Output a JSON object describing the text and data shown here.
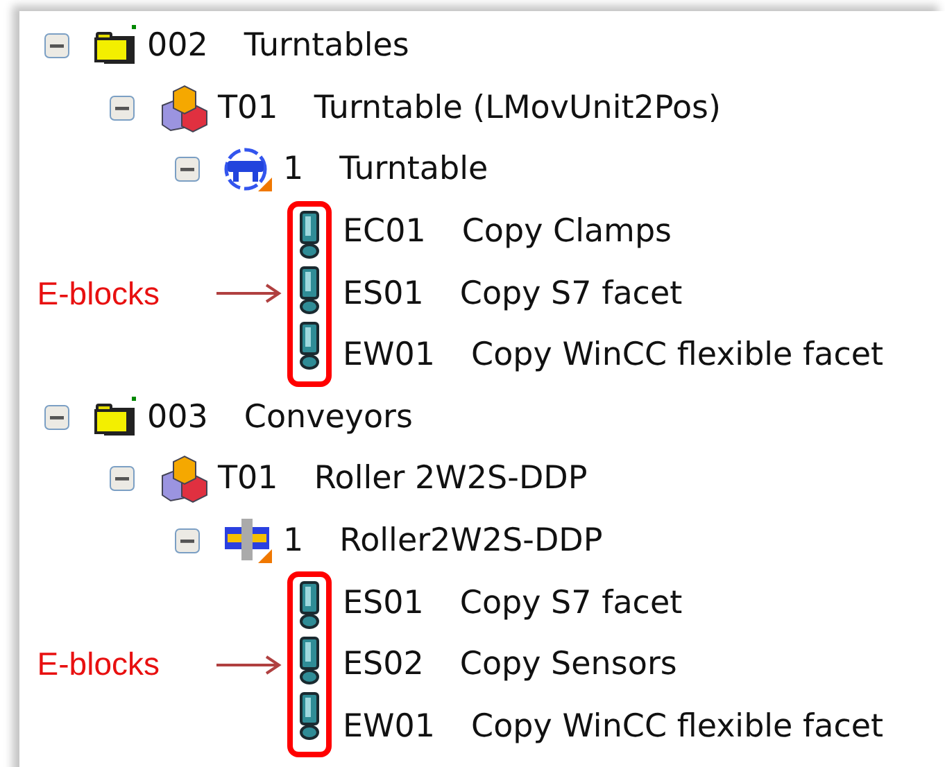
{
  "tree": [
    {
      "kind": "folder",
      "code": "002",
      "name": "Turntables",
      "expanded": true,
      "children": [
        {
          "kind": "unit",
          "code": "T01",
          "name": "Turntable (LMovUnit2Pos)",
          "expanded": true,
          "children": [
            {
              "kind": "turntable",
              "code": "1",
              "name": "Turntable",
              "expanded": true,
              "annotation": "E-blocks",
              "children": [
                {
                  "kind": "eblock",
                  "code": "EC01",
                  "name": "Copy Clamps"
                },
                {
                  "kind": "eblock",
                  "code": "ES01",
                  "name": "Copy S7 facet"
                },
                {
                  "kind": "eblock",
                  "code": "EW01",
                  "name": "Copy WinCC flexible facet"
                }
              ]
            }
          ]
        }
      ]
    },
    {
      "kind": "folder",
      "code": "003",
      "name": "Conveyors",
      "expanded": true,
      "children": [
        {
          "kind": "unit",
          "code": "T01",
          "name": "Roller 2W2S-DDP",
          "expanded": true,
          "children": [
            {
              "kind": "roller",
              "code": "1",
              "name": "Roller2W2S-DDP",
              "expanded": true,
              "annotation": "E-blocks",
              "children": [
                {
                  "kind": "eblock",
                  "code": "ES01",
                  "name": "Copy S7 facet"
                },
                {
                  "kind": "eblock",
                  "code": "ES02",
                  "name": "Copy Sensors"
                },
                {
                  "kind": "eblock",
                  "code": "EW01",
                  "name": "Copy WinCC flexible facet"
                }
              ]
            }
          ]
        }
      ]
    }
  ]
}
